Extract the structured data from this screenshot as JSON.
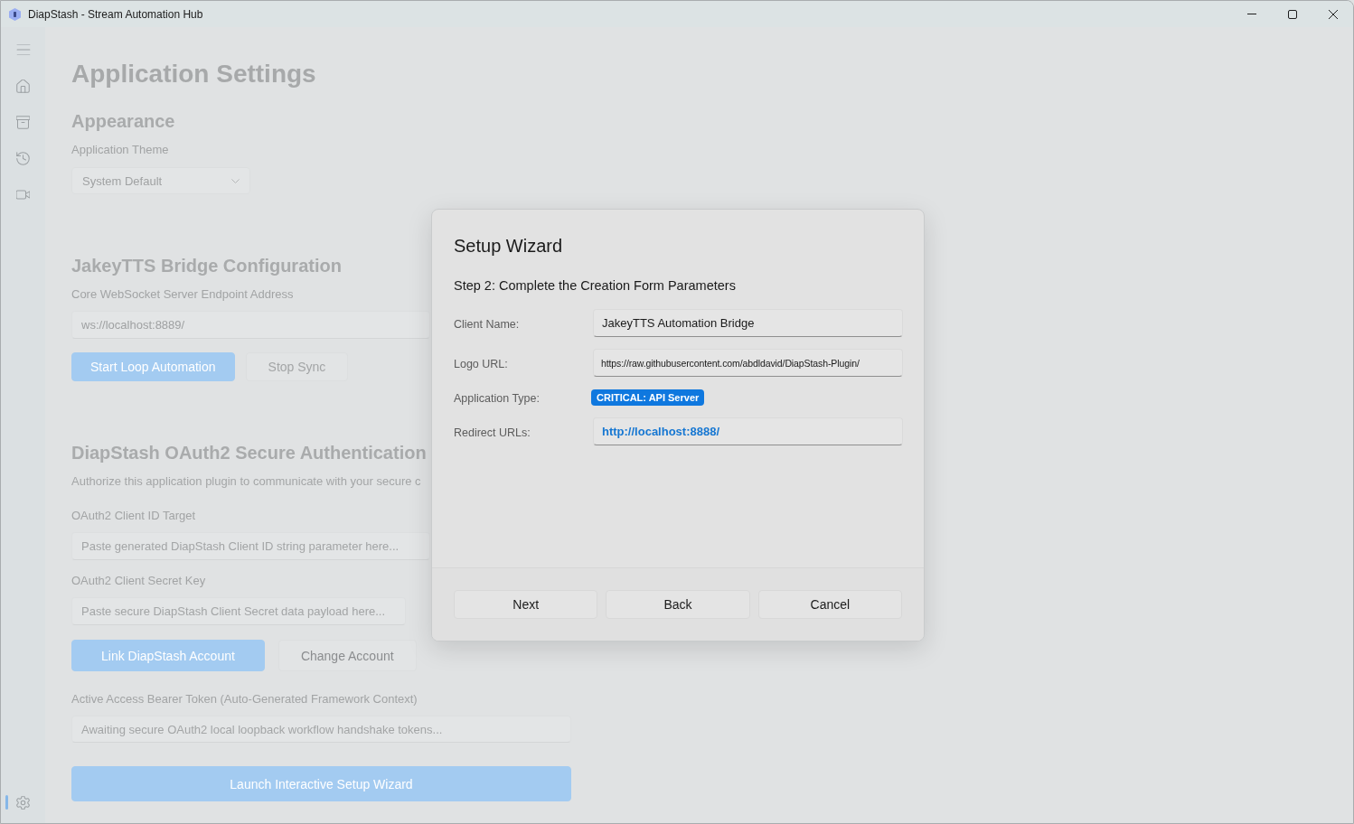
{
  "window": {
    "title": "DiapStash - Stream Automation Hub"
  },
  "sidebar": {
    "items": [
      {
        "selected": false
      },
      {
        "selected": false
      },
      {
        "selected": false
      },
      {
        "selected": false
      }
    ],
    "footer_items": [
      {
        "selected": true
      }
    ]
  },
  "settings": {
    "title": "Application Settings",
    "appearance": {
      "heading": "Appearance",
      "theme_label": "Application Theme",
      "theme_value": "System Default"
    },
    "bridge": {
      "heading": "JakeyTTS Bridge Configuration",
      "endpoint_label": "Core WebSocket Server Endpoint Address",
      "endpoint_value": "ws://localhost:8889/",
      "buttons": [
        {
          "label": "Start Loop Automation",
          "kind": "primary",
          "disabled": false
        },
        {
          "label": "Stop Sync",
          "kind": "secondary",
          "disabled": true
        }
      ]
    },
    "oauth": {
      "heading": "DiapStash OAuth2 Secure Authentication",
      "description": "Authorize this application plugin to communicate with your secure c",
      "client_id": {
        "label": "OAuth2 Client ID Target",
        "placeholder": "Paste generated DiapStash Client ID string parameter here..."
      },
      "client_secret": {
        "label": "OAuth2 Client Secret Key",
        "placeholder": "Paste secure DiapStash Client Secret data payload here..."
      },
      "buttons": [
        {
          "label": "Link DiapStash Account",
          "kind": "primary",
          "disabled": false
        },
        {
          "label": "Change Account",
          "kind": "secondary",
          "disabled": false
        }
      ],
      "token": {
        "label": "Active Access Bearer Token (Auto-Generated Framework Context)",
        "placeholder": "Awaiting secure OAuth2 local loopback workflow handshake tokens..."
      },
      "wizard_button": "Launch Interactive Setup Wizard"
    }
  },
  "dialog": {
    "title": "Setup Wizard",
    "step": "Step 2: Complete the Creation Form Parameters",
    "fields": [
      {
        "kind": "text",
        "label": "Client Name:",
        "value": "JakeyTTS Automation Bridge"
      },
      {
        "kind": "url",
        "label": "Logo URL:",
        "value": "https://raw.githubusercontent.com/abdldavid/DiapStash-Plugin/"
      },
      {
        "kind": "badge",
        "label": "Application Type:",
        "value": "CRITICAL: API Server"
      },
      {
        "kind": "link",
        "label": "Redirect URLs:",
        "value": "http://localhost:8888/"
      }
    ],
    "buttons": [
      "Next",
      "Back",
      "Cancel"
    ]
  }
}
